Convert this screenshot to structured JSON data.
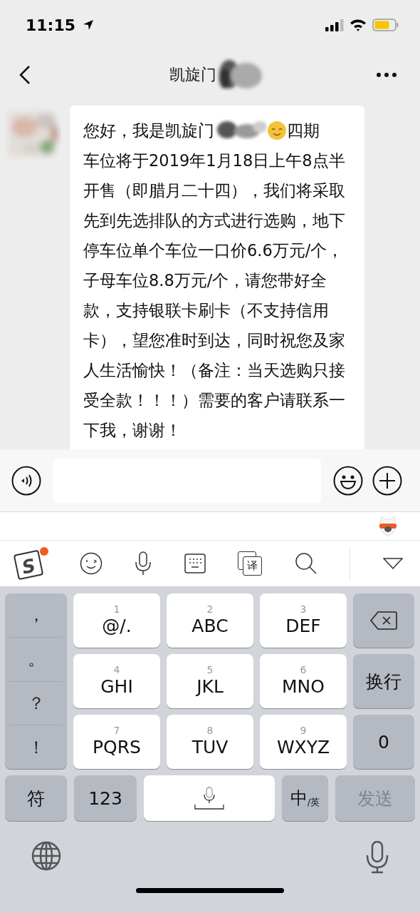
{
  "status_bar": {
    "time": "11:15"
  },
  "nav": {
    "title": "凯旋门"
  },
  "message": {
    "parts": [
      {
        "kind": "text",
        "text": "您好，我是凯旋门"
      },
      {
        "kind": "redaction"
      },
      {
        "kind": "emoji"
      },
      {
        "kind": "text",
        "text": "四期"
      }
    ]
  },
  "message_body": {
    "text": "车位将于2019年1月18日上午8点半开售（即腊月二十四），我们将采取先到先选排队的方式进行选购，地下停车位单个车位一口价6.6万元/个，子母车位8.8万元/个，请您带好全款，支持银联卡刷卡（不支持信用卡），望您准时到达，同时祝您及家人生活愉快！（备注：当天选购只接受全款！！！）需要的客户请联系一下我，谢谢！"
  },
  "toolbar": {
    "logo": {
      "text": "S",
      "badge": true
    },
    "translate_label": "译"
  },
  "keyboard": {
    "punctuation": [
      "，",
      "。",
      "？",
      "！"
    ],
    "keys": [
      {
        "digit": "1",
        "label": "@/."
      },
      {
        "digit": "2",
        "label": "ABC"
      },
      {
        "digit": "3",
        "label": "DEF"
      },
      {
        "digit": "4",
        "label": "GHI"
      },
      {
        "digit": "5",
        "label": "JKL"
      },
      {
        "digit": "6",
        "label": "MNO"
      },
      {
        "digit": "7",
        "label": "PQRS"
      },
      {
        "digit": "8",
        "label": "TUV"
      },
      {
        "digit": "9",
        "label": "WXYZ"
      }
    ],
    "side_keys": [
      {
        "kind": "backspace"
      },
      {
        "kind": "text",
        "label": "换行"
      },
      {
        "kind": "text",
        "label": "0"
      }
    ],
    "bottom_row": [
      {
        "kind": "text",
        "label": "符",
        "disabled": false
      },
      {
        "kind": "text",
        "label": "123",
        "disabled": false
      },
      {
        "kind": "space",
        "disabled": false
      },
      {
        "kind": "lang",
        "main": "中",
        "sub": "/英",
        "disabled": false
      },
      {
        "kind": "text",
        "label": "发送",
        "disabled": true
      }
    ]
  }
}
